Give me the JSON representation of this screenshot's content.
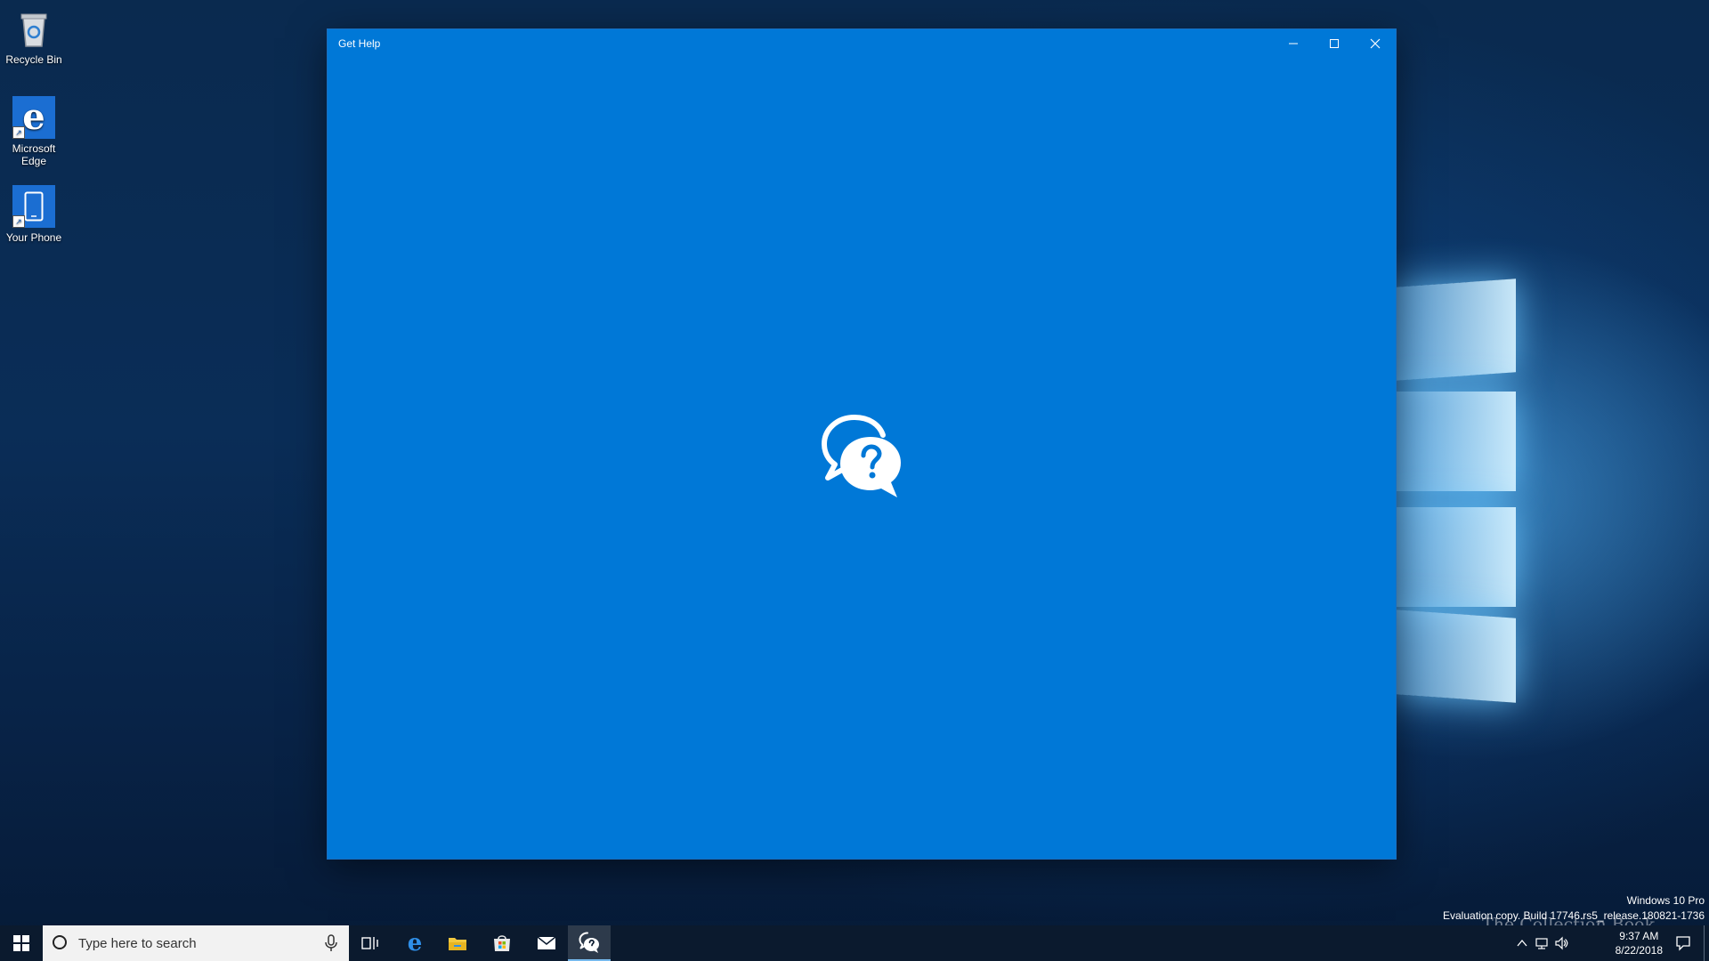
{
  "desktop": {
    "icons": [
      {
        "label": "Recycle Bin",
        "icon": "recycle-bin-icon"
      },
      {
        "label": "Microsoft Edge",
        "icon": "edge-icon"
      },
      {
        "label": "Your Phone",
        "icon": "phone-icon"
      }
    ],
    "watermark": {
      "edition": "Windows 10 Pro",
      "build": "Evaluation copy. Build 17746.rs5_release.180821-1736"
    },
    "stamp": "The Collection Book"
  },
  "window": {
    "title": "Get Help",
    "background_color": "#0078d7",
    "splash_icon": "chat-question-icon",
    "controls": {
      "minimize": "minimize-icon",
      "maximize": "maximize-icon",
      "close": "close-icon"
    }
  },
  "taskbar": {
    "search_placeholder": "Type here to search",
    "pinned": [
      "task-view-icon",
      "edge-icon",
      "file-explorer-icon",
      "store-icon",
      "mail-icon",
      "get-help-icon"
    ],
    "active_app": "Get Help",
    "clock": {
      "time": "9:37 AM",
      "date": "8/22/2018"
    }
  }
}
